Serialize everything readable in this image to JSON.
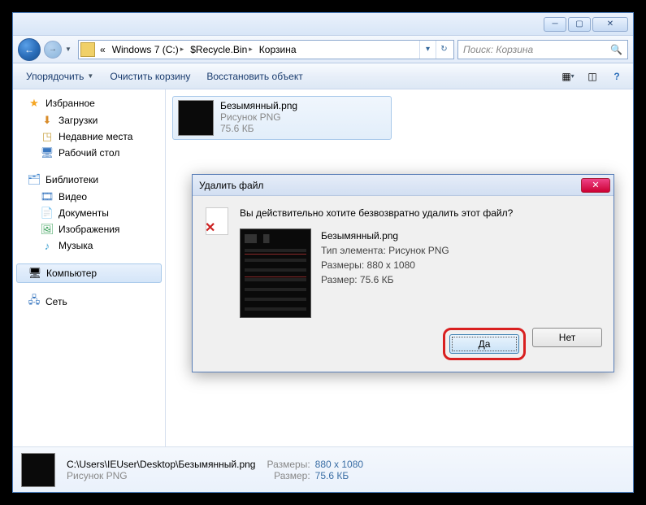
{
  "address": {
    "crumbs": [
      "«",
      "Windows 7 (C:)",
      "$Recycle.Bin",
      "Корзина"
    ]
  },
  "search": {
    "placeholder": "Поиск: Корзина"
  },
  "toolbar": {
    "organize": "Упорядочить",
    "empty": "Очистить корзину",
    "restore": "Восстановить объект"
  },
  "sidebar": {
    "favorites": {
      "label": "Избранное",
      "items": [
        "Загрузки",
        "Недавние места",
        "Рабочий стол"
      ]
    },
    "libraries": {
      "label": "Библиотеки",
      "items": [
        "Видео",
        "Документы",
        "Изображения",
        "Музыка"
      ]
    },
    "computer": "Компьютер",
    "network": "Сеть"
  },
  "file": {
    "name": "Безымянный.png",
    "type": "Рисунок PNG",
    "size": "75.6 КБ"
  },
  "dialog": {
    "title": "Удалить файл",
    "question": "Вы действительно хотите безвозвратно удалить этот файл?",
    "filename": "Безымянный.png",
    "type_label": "Тип элемента:",
    "type_value": "Рисунок PNG",
    "dims_label": "Размеры:",
    "dims_value": "880 x 1080",
    "size_label": "Размер:",
    "size_value": "75.6 КБ",
    "yes": "Да",
    "no": "Нет"
  },
  "status": {
    "path": "C:\\Users\\IEUser\\Desktop\\Безымянный.png",
    "type": "Рисунок PNG",
    "dims_label": "Размеры:",
    "dims_value": "880 x 1080",
    "size_label": "Размер:",
    "size_value": "75.6 КБ"
  }
}
